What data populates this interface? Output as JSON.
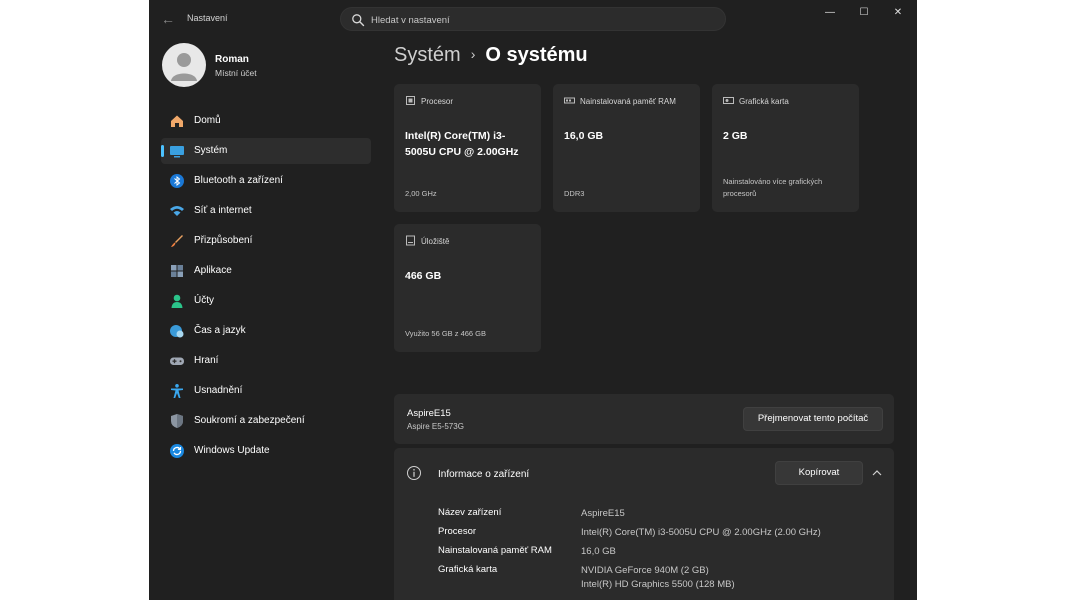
{
  "window": {
    "app_title": "Nastavení",
    "back_glyph": "←",
    "minimize_glyph": "—",
    "maximize_glyph": "☐",
    "close_glyph": "✕"
  },
  "search": {
    "placeholder": "Hledat v nastavení"
  },
  "profile": {
    "name": "Roman",
    "account_type": "Místní účet"
  },
  "sidebar": {
    "items": [
      {
        "label": "Domů",
        "icon": "home-icon"
      },
      {
        "label": "Systém",
        "icon": "system-icon",
        "active": true
      },
      {
        "label": "Bluetooth a zařízení",
        "icon": "bluetooth-icon"
      },
      {
        "label": "Síť a internet",
        "icon": "wifi-icon"
      },
      {
        "label": "Přizpůsobení",
        "icon": "brush-icon"
      },
      {
        "label": "Aplikace",
        "icon": "apps-icon"
      },
      {
        "label": "Účty",
        "icon": "accounts-icon"
      },
      {
        "label": "Čas a jazyk",
        "icon": "globe-clock-icon"
      },
      {
        "label": "Hraní",
        "icon": "gamepad-icon"
      },
      {
        "label": "Usnadnění",
        "icon": "accessibility-icon"
      },
      {
        "label": "Soukromí a zabezpečení",
        "icon": "shield-icon"
      },
      {
        "label": "Windows Update",
        "icon": "update-icon"
      }
    ]
  },
  "breadcrumb": {
    "parent": "Systém",
    "separator": "›",
    "current": "O systému"
  },
  "cards": {
    "cpu": {
      "label": "Procesor",
      "value": "Intel(R) Core(TM) i3-5005U CPU @ 2.00GHz",
      "sub": "2,00 GHz"
    },
    "ram": {
      "label": "Nainstalovaná paměť RAM",
      "value": "16,0 GB",
      "sub": "DDR3"
    },
    "gpu": {
      "label": "Grafická karta",
      "value": "2 GB",
      "sub": "Nainstalováno více grafických procesorů"
    },
    "storage": {
      "label": "Úložiště",
      "value": "466 GB",
      "sub": "Využito 56 GB z 466 GB"
    }
  },
  "device": {
    "name": "AspireE15",
    "model": "Aspire E5-573G",
    "rename_button": "Přejmenovat tento počítač"
  },
  "info": {
    "title": "Informace o zařízení",
    "copy_button": "Kopírovat",
    "rows": [
      {
        "label": "Název zařízení",
        "value": "AspireE15"
      },
      {
        "label": "Procesor",
        "value": "Intel(R) Core(TM) i3-5005U CPU @ 2.00GHz (2.00 GHz)"
      },
      {
        "label": "Nainstalovaná paměť RAM",
        "value": "16,0 GB"
      },
      {
        "label": "Grafická karta",
        "value": "NVIDIA GeForce 940M (2 GB)",
        "value2": "Intel(R) HD Graphics 5500 (128 MB)"
      }
    ]
  },
  "colors": {
    "background": "#202020",
    "card": "#2b2b2b",
    "accent": "#4cc2ff"
  }
}
